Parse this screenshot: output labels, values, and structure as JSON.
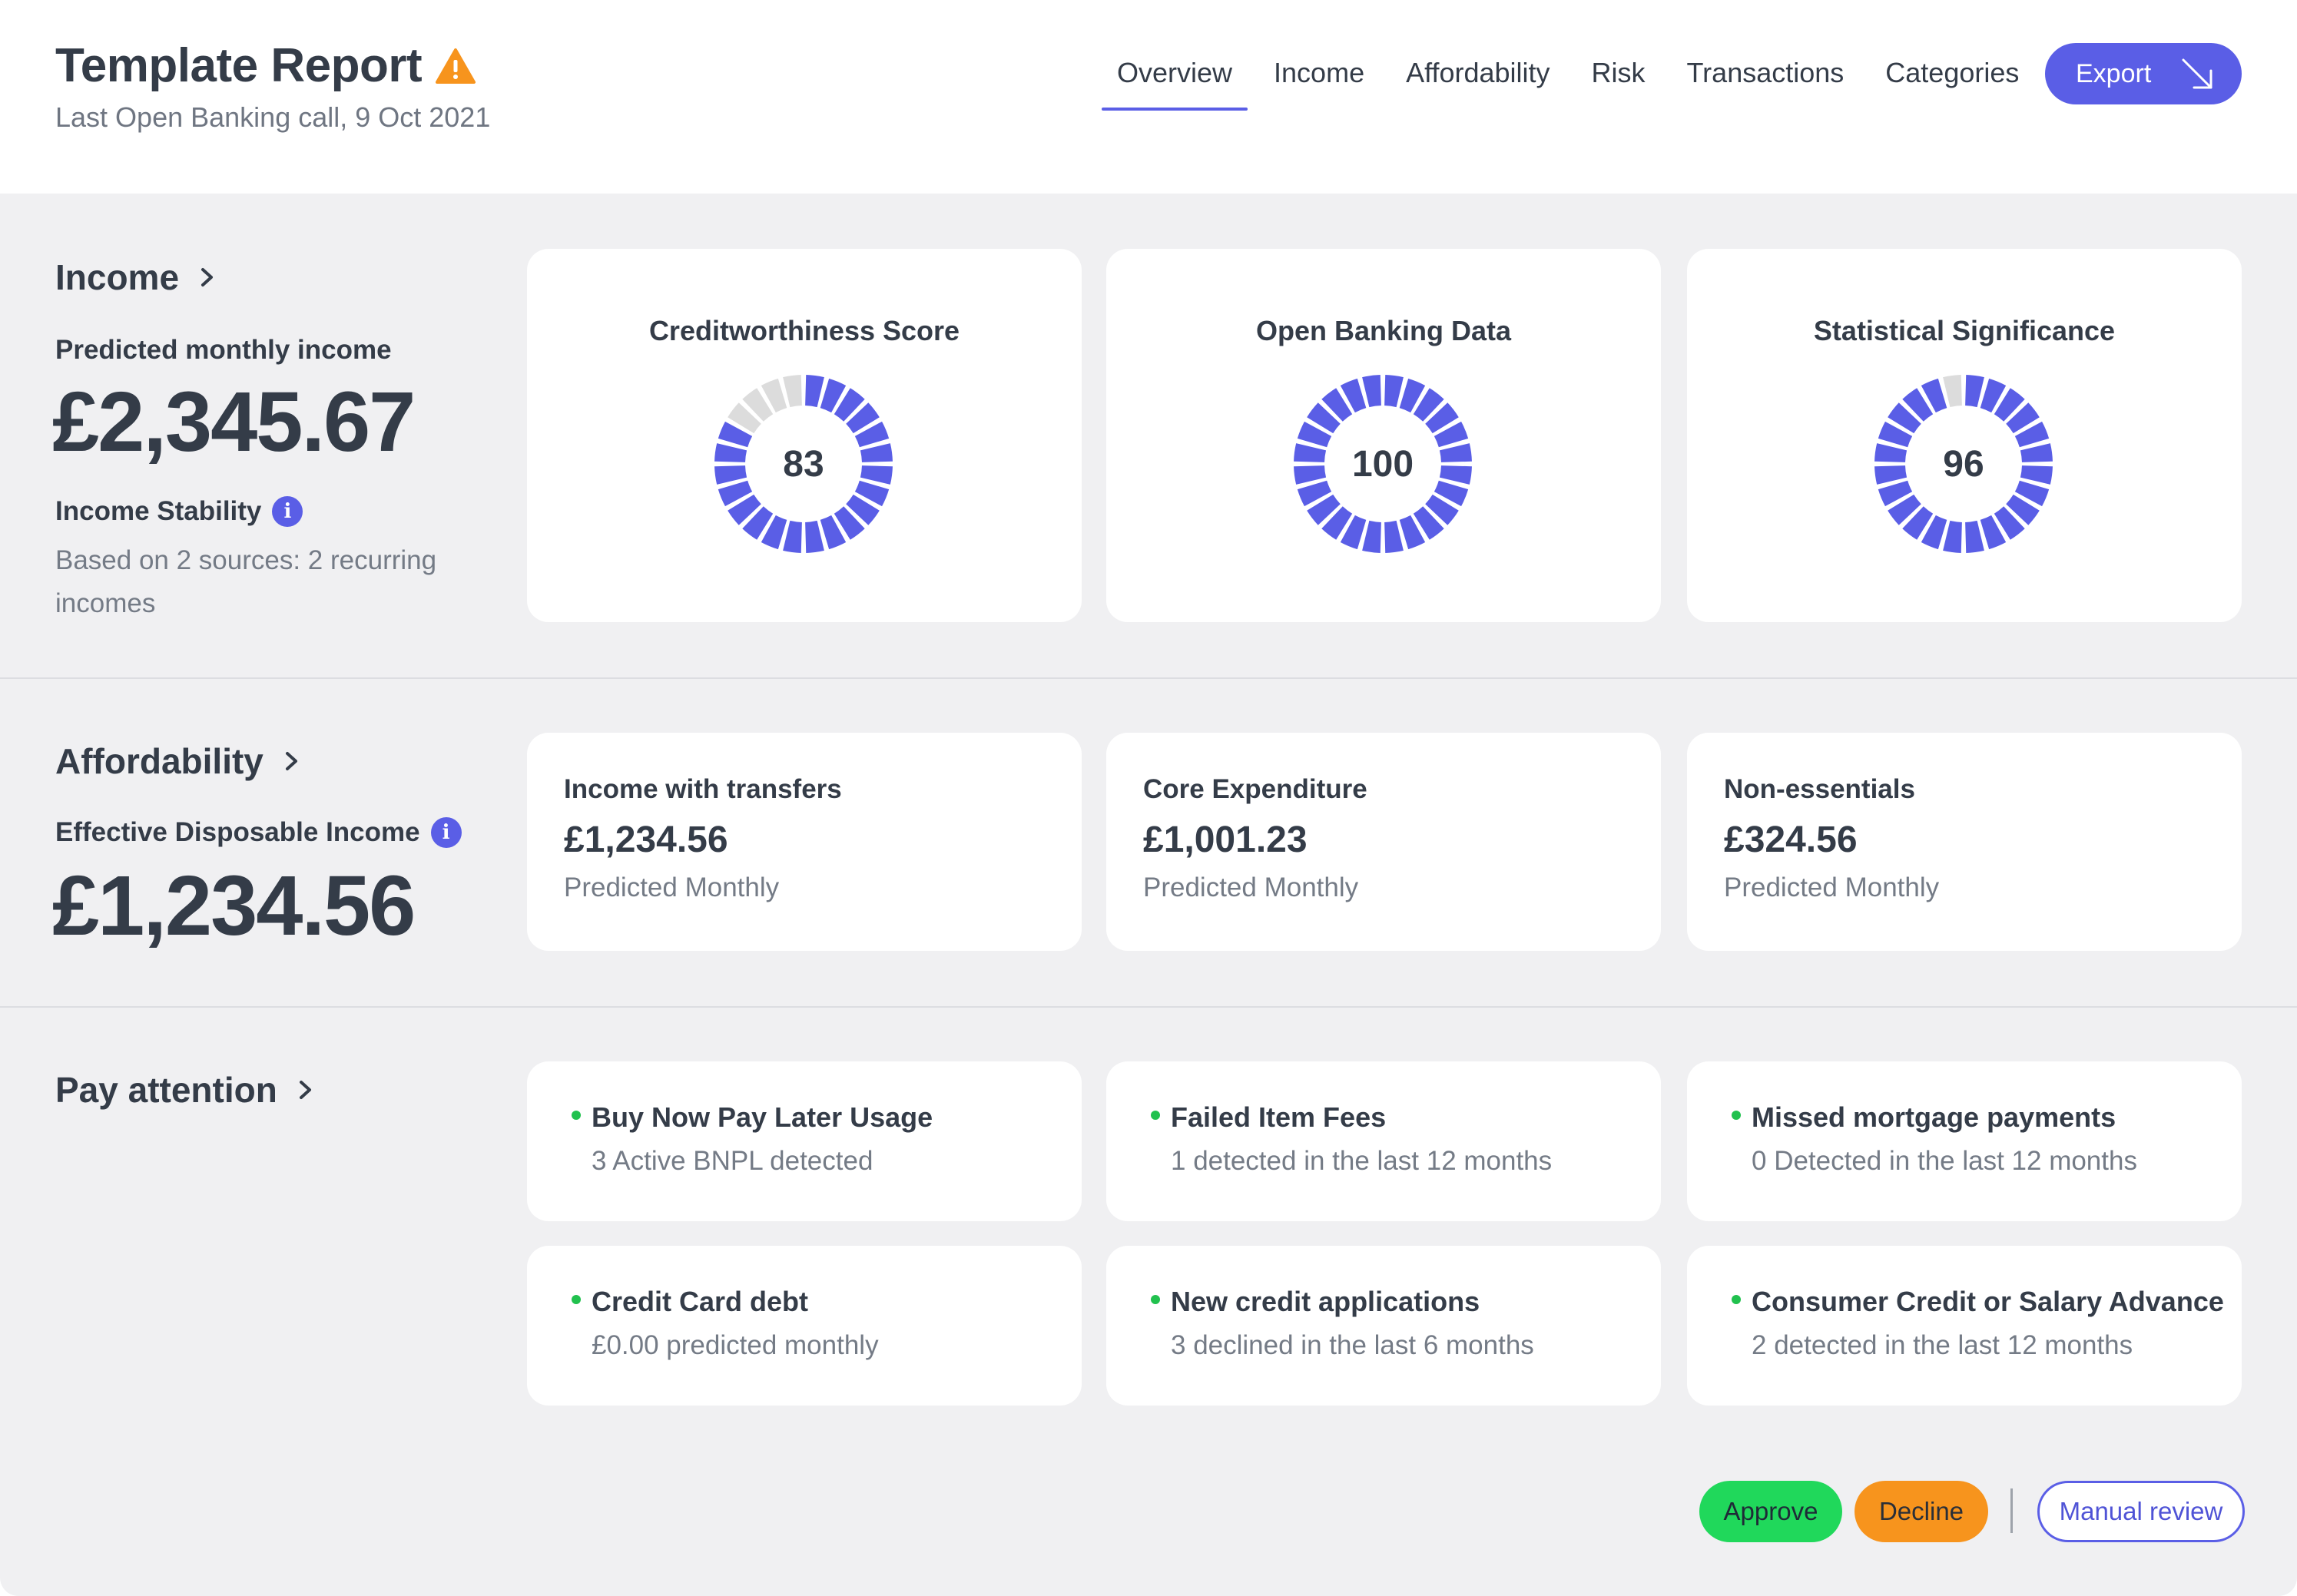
{
  "header": {
    "title": "Template Report",
    "subtitle": "Last Open Banking call, 9 Oct 2021",
    "warning_icon": "warning-triangle-icon",
    "nav": [
      "Overview",
      "Income",
      "Affordability",
      "Risk",
      "Transactions",
      "Categories"
    ],
    "active_tab": "Overview",
    "export_label": "Export",
    "export_icon": "arrow-down-right-icon"
  },
  "income": {
    "section_title": "Income",
    "predicted_label": "Predicted monthly income",
    "predicted_value": "£2,345.67",
    "stability_label": "Income Stability",
    "stability_desc_line1": "Based on 2 sources: 2 recurring",
    "stability_desc_line2": "incomes",
    "gauges": [
      {
        "title": "Creditworthiness Score",
        "value": "83",
        "score": 83
      },
      {
        "title": "Open Banking Data",
        "value": "100",
        "score": 100
      },
      {
        "title": "Statistical Significance",
        "value": "96",
        "score": 96
      }
    ]
  },
  "affordability": {
    "section_title": "Affordability",
    "edi_label": "Effective Disposable Income",
    "edi_value": "£1,234.56",
    "cards": [
      {
        "title": "Income with transfers",
        "value": "£1,234.56",
        "sub": "Predicted Monthly"
      },
      {
        "title": "Core Expenditure",
        "value": "£1,001.23",
        "sub": "Predicted Monthly"
      },
      {
        "title": "Non-essentials",
        "value": "£324.56",
        "sub": "Predicted Monthly"
      }
    ]
  },
  "attention": {
    "section_title": "Pay attention",
    "items": [
      {
        "title": "Buy Now Pay Later Usage",
        "sub": "3 Active BNPL detected"
      },
      {
        "title": "Failed Item Fees",
        "sub": "1 detected in the last 12 months"
      },
      {
        "title": "Missed mortgage payments",
        "sub": "0 Detected in the last 12 months"
      },
      {
        "title": "Credit Card debt",
        "sub": "£0.00 predicted monthly"
      },
      {
        "title": "New credit applications",
        "sub": "3 declined in the last 6 months"
      },
      {
        "title": "Consumer Credit or Salary Advance",
        "sub": "2 detected in the last 12 months"
      }
    ]
  },
  "actions": {
    "approve": "Approve",
    "decline": "Decline",
    "manual_review": "Manual review"
  },
  "colors": {
    "accent": "#5a5ee6",
    "gauge_empty": "#dcdcdc",
    "approve": "#20d85b",
    "decline": "#f7941d",
    "warning": "#f7941d",
    "status_dot": "#21c14e"
  }
}
